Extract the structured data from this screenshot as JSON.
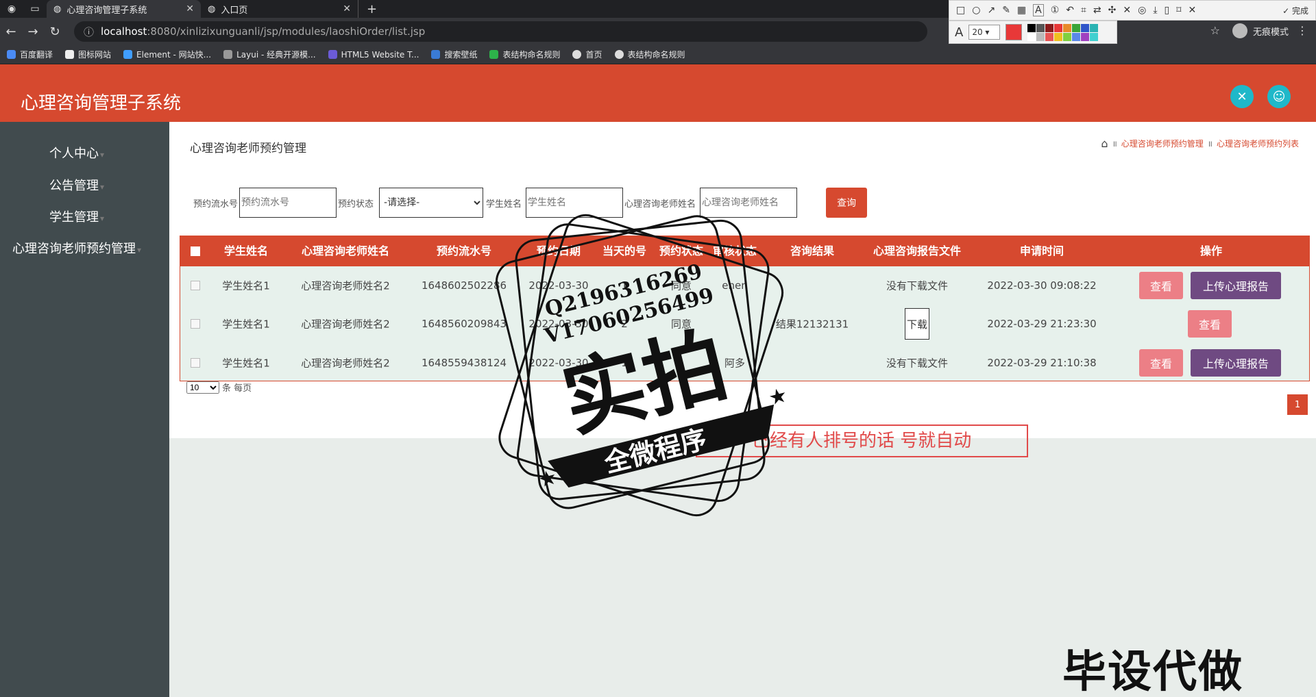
{
  "browser": {
    "tabs": [
      {
        "title": "心理咨询管理子系统",
        "active": true
      },
      {
        "title": "入口页",
        "active": false
      }
    ],
    "url_host": "localhost",
    "url_path": ":8080/xinlizixunguanli/jsp/modules/laoshiOrder/list.jsp",
    "incognito_label": "无痕模式",
    "bookmarks": [
      "百度翻译",
      "图标网站",
      "Element - 网站快...",
      "Layui - 经典开源模...",
      "HTML5 Website T...",
      "搜索壁纸",
      "表结构命名规则",
      "首页",
      "表结构命名规则"
    ]
  },
  "snip_toolbar": {
    "done_label": "完成",
    "font_size": "20",
    "current_color": "#e83838",
    "palette": [
      "#000000",
      "#555555",
      "#8b1a1a",
      "#e83838",
      "#e88a2a",
      "#3aa537",
      "#2f56c9",
      "#2ab3b3",
      "#ffffff",
      "#bbbbbb",
      "#e85555",
      "#f0c020",
      "#80d040",
      "#5a88e8",
      "#a040c0",
      "#40d0d0"
    ]
  },
  "app": {
    "title": "心理咨询管理子系统",
    "colors": {
      "primary": "#d6492f",
      "sidebar": "#414b4e",
      "teal": "#1fb8c9",
      "view": "#ec7f86",
      "upload": "#6f4a82"
    }
  },
  "sidebar": {
    "items": [
      "个人中心",
      "公告管理",
      "学生管理",
      "心理咨询老师预约管理"
    ]
  },
  "page": {
    "title": "心理咨询老师预约管理",
    "breadcrumb": [
      "心理咨询老师预约管理",
      "心理咨询老师预约列表"
    ]
  },
  "search": {
    "order_no_label": "预约流水号",
    "order_no_placeholder": "预约流水号",
    "status_label": "预约状态",
    "status_selected": "-请选择-",
    "student_label": "学生姓名",
    "student_placeholder": "学生姓名",
    "teacher_label": "心理咨询老师姓名",
    "teacher_placeholder": "心理咨询老师姓名",
    "query_label": "查询"
  },
  "table": {
    "columns": [
      "学生姓名",
      "心理咨询老师姓名",
      "预约流水号",
      "预约日期",
      "当天的号",
      "预约状态",
      "审核状态",
      "咨询结果",
      "心理咨询报告文件",
      "申请时间",
      "操作"
    ],
    "rows": [
      {
        "student": "学生姓名1",
        "teacher": "心理咨询老师姓名2",
        "order_no": "1648602502286",
        "date": "2022-03-30",
        "num": "1",
        "status": "同意",
        "audit": "enen",
        "result": "",
        "report": "没有下载文件",
        "time": "2022-03-30 09:08:22",
        "upload": true
      },
      {
        "student": "学生姓名1",
        "teacher": "心理咨询老师姓名2",
        "order_no": "1648560209843",
        "date": "2022-03-30",
        "num": "2",
        "status": "同意",
        "audit": "",
        "result": "结果12132131",
        "report": "下载",
        "time": "2022-03-29 21:23:30",
        "upload": false
      },
      {
        "student": "学生姓名1",
        "teacher": "心理咨询老师姓名2",
        "order_no": "1648559438124",
        "date": "2022-03-30",
        "num": "1",
        "status": "",
        "audit": "阿多",
        "result": "",
        "report": "没有下载文件",
        "time": "2022-03-29 21:10:38",
        "upload": true
      }
    ],
    "view_label": "查看",
    "upload_label": "上传心理报告"
  },
  "pagination": {
    "page_size": "10",
    "per_page_label": "条 每页",
    "current_page": "1"
  },
  "annotation_text": "已经有人排号的话  号就自动",
  "stamp": {
    "line1": "Q2196316269",
    "line2": "V17060256499",
    "big": "实拍",
    "banner": "全微程序"
  },
  "watermark": "毕设代做"
}
